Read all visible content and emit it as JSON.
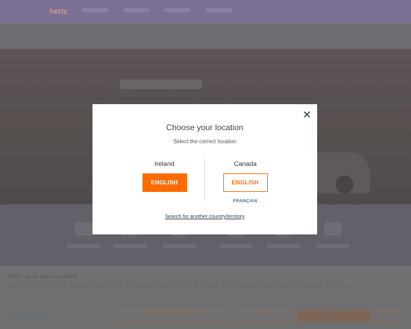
{
  "header": {
    "brand": "hertz"
  },
  "cookie_banner": {
    "title": "Hertz cares about cookies",
    "text": "We use cookies to enhance your experience, analyse our traffic and personalise content. You can accept all cookies, reject non-essential cookies or manage your preferences at any time.",
    "manage_link": "Manage cookie settings",
    "buttons": [
      "Reject non-essential cookies",
      "Accept",
      "Accept all cookies",
      "Close"
    ]
  },
  "modal": {
    "title": "Choose your location",
    "subtitle": "Select the correct location",
    "close_icon": "close-icon",
    "locations": [
      {
        "country": "Ireland",
        "languages": [
          "ENGLISH"
        ]
      },
      {
        "country": "Canada",
        "languages": [
          "ENGLISH",
          "FRANÇAIS"
        ]
      }
    ],
    "search_link": "Search for another country/territory"
  },
  "colors": {
    "accent": "#ff6a00",
    "link": "#2a6e9a",
    "overlay_header": "#7b6f93"
  }
}
